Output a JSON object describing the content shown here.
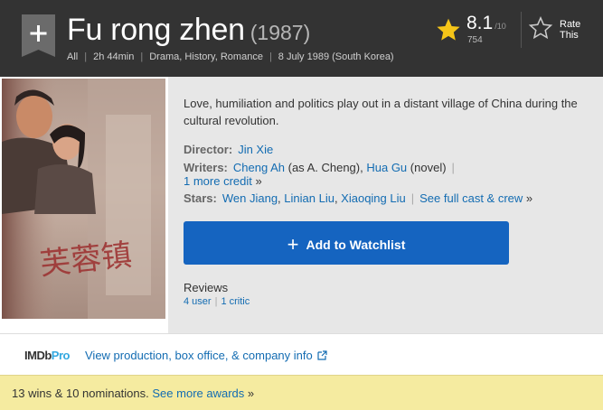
{
  "header": {
    "title": "Fu rong zhen",
    "year": "(1987)",
    "certificate": "All",
    "runtime": "2h 44min",
    "genres": "Drama, History, Romance",
    "release": "8 July 1989 (South Korea)"
  },
  "rating": {
    "value": "8.1",
    "best": "/10",
    "count": "754",
    "rate_label_1": "Rate",
    "rate_label_2": "This"
  },
  "summary": "Love, humiliation and politics play out in a distant village of China during the cultural revolution.",
  "credits": {
    "director_label": "Director:",
    "director": "Jin Xie",
    "writers_label": "Writers:",
    "writer_1": "Cheng Ah",
    "writer_1_note": "(as A. Cheng),",
    "writer_2": "Hua Gu",
    "writer_2_note": "(novel)",
    "more_credit": "1 more credit",
    "stars_label": "Stars:",
    "star_1": "Wen Jiang",
    "star_2": "Linian Liu",
    "star_3": "Xiaoqing Liu",
    "full_cast": "See full cast & crew"
  },
  "watchlist": {
    "label": "Add to Watchlist"
  },
  "reviews": {
    "heading": "Reviews",
    "user": "4 user",
    "critic": "1 critic"
  },
  "pro": {
    "logo_a": "IMDb",
    "logo_b": "Pro",
    "link": "View production, box office, & company info"
  },
  "awards": {
    "text": "13 wins & 10 nominations.",
    "link": "See more awards"
  },
  "poster": {
    "title_glyphs": "芙蓉镇"
  },
  "colors": {
    "header_bg": "#333333",
    "accent_blue": "#136cb2",
    "button_blue": "#1564c0",
    "star_gold": "#f5c518",
    "awards_bg": "#f5eba0"
  }
}
